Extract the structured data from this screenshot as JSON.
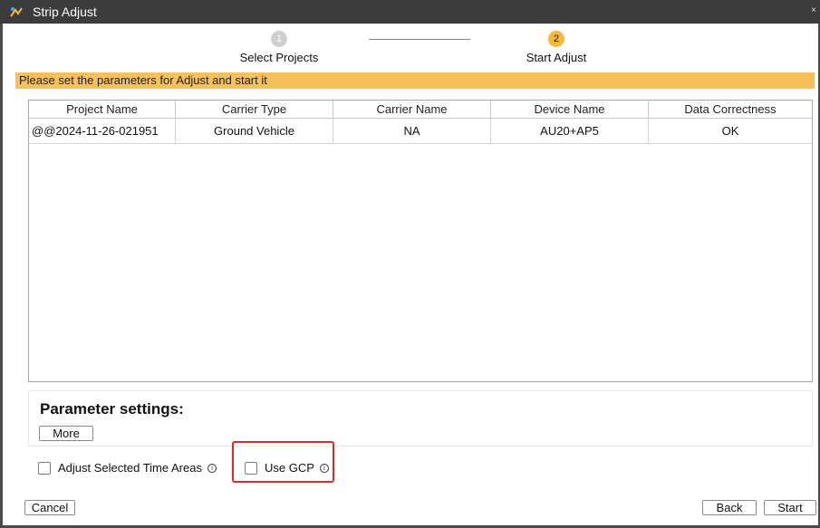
{
  "window": {
    "title": "Strip Adjust",
    "close_glyph": "×"
  },
  "steps": [
    {
      "number": "1",
      "label": "Select Projects",
      "state": "done"
    },
    {
      "number": "2",
      "label": "Start Adjust",
      "state": "active"
    }
  ],
  "banner": {
    "text": "Please set the parameters for Adjust and start it"
  },
  "table": {
    "columns": [
      "Project Name",
      "Carrier Type",
      "Carrier Name",
      "Device Name",
      "Data Correctness"
    ],
    "rows": [
      [
        "@@2024-11-26-021951",
        "Ground Vehicle",
        "NA",
        "AU20+AP5",
        "OK"
      ]
    ]
  },
  "parameters": {
    "title": "Parameter settings:",
    "more_label": "More"
  },
  "options": {
    "adjust_time_areas": {
      "label": "Adjust Selected Time Areas",
      "checked": false
    },
    "use_gcp": {
      "label": "Use GCP",
      "checked": false
    }
  },
  "footer": {
    "cancel_label": "Cancel",
    "back_label": "Back",
    "start_label": "Start"
  },
  "colors": {
    "accent": "#f8c05a",
    "step_active": "#f5b93a",
    "highlight": "#e0282d",
    "titlebar": "#3c3c3c"
  }
}
